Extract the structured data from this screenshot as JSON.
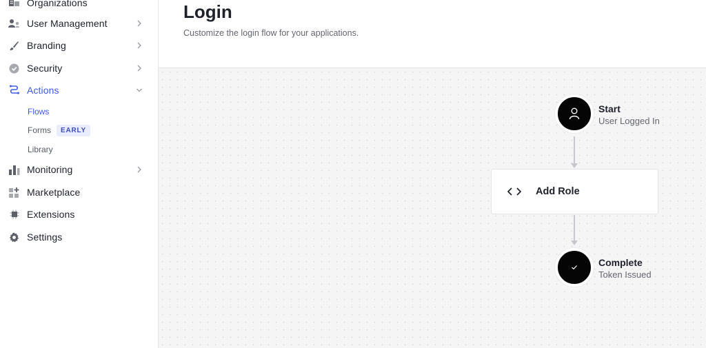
{
  "sidebar": {
    "items": [
      {
        "label": "Organizations",
        "icon": "organizations-icon"
      },
      {
        "label": "User Management",
        "icon": "users-icon"
      },
      {
        "label": "Branding",
        "icon": "brush-icon"
      },
      {
        "label": "Security",
        "icon": "shield-check-icon"
      },
      {
        "label": "Actions",
        "icon": "actions-flow-icon"
      },
      {
        "label": "Monitoring",
        "icon": "bar-chart-icon"
      },
      {
        "label": "Marketplace",
        "icon": "marketplace-icon"
      },
      {
        "label": "Extensions",
        "icon": "chip-icon"
      },
      {
        "label": "Settings",
        "icon": "gear-icon"
      }
    ],
    "actions_sub": [
      {
        "label": "Flows"
      },
      {
        "label": "Forms",
        "badge": "EARLY"
      },
      {
        "label": "Library"
      }
    ]
  },
  "header": {
    "title": "Login",
    "description": "Customize the login flow for your applications."
  },
  "flow": {
    "start": {
      "title": "Start",
      "subtitle": "User Logged In",
      "icon": "user-icon"
    },
    "action": {
      "label": "Add Role",
      "icon": "code-icon"
    },
    "complete": {
      "title": "Complete",
      "subtitle": "Token Issued",
      "icon": "check-icon"
    }
  },
  "colors": {
    "accent": "#3f59e4",
    "node": "#050505",
    "badge_bg": "#e8ecfd",
    "badge_text": "#3f4bb4",
    "connector": "#c5c7cc"
  }
}
